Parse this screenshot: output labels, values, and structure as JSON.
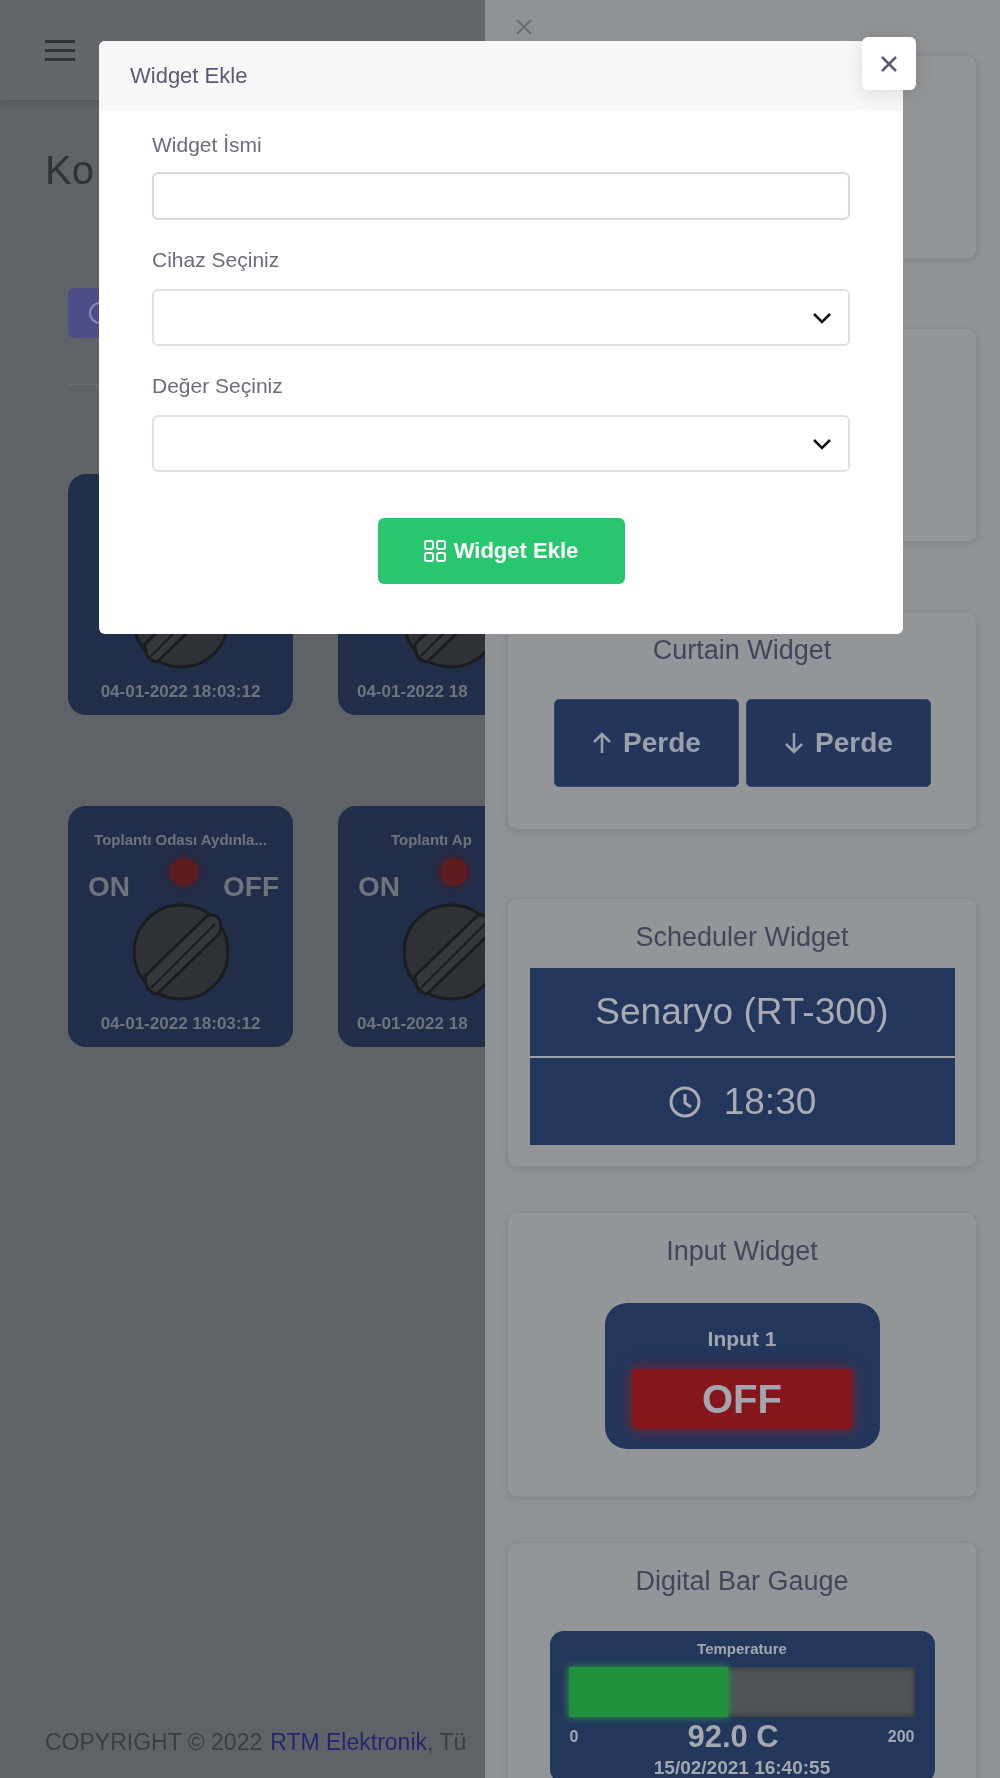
{
  "page": {
    "title": "Ko",
    "switch_rows": [
      {
        "cards": [
          {
            "date": "04-01-2022 18:03:12"
          },
          {
            "date": "04-01-2022 18"
          }
        ]
      },
      {
        "cards": [
          {
            "title": "Toplantı Odası Aydınla...",
            "on_label": "ON",
            "off_label": "OFF",
            "lamp_on": false,
            "date": "04-01-2022 18:03:12"
          },
          {
            "title": "Toplantı Ap",
            "on_label": "ON",
            "lamp_on": false,
            "date": "04-01-2022 18"
          }
        ]
      }
    ]
  },
  "footer": {
    "copyright": "COPYRIGHT © 2022",
    "company_link": "RTM Elektronik",
    "trailing": ", Tü"
  },
  "side_panel": {
    "widgets": [
      {
        "kind": "empty"
      },
      {
        "kind": "empty"
      },
      {
        "kind": "curtain",
        "title": "Curtain Widget",
        "buttons": [
          {
            "kind": "up",
            "label": "Perde"
          },
          {
            "kind": "down",
            "label": "Perde"
          }
        ]
      },
      {
        "kind": "scheduler",
        "title": "Scheduler Widget",
        "scene": "Senaryo (RT-300)",
        "time": "18:30"
      },
      {
        "kind": "input",
        "title": "Input Widget",
        "name": "Input 1",
        "value": "OFF",
        "on": false
      },
      {
        "kind": "bar_gauge",
        "title": "Digital Bar Gauge",
        "label": "Temperature",
        "level": 0.46,
        "min": "0",
        "max": "200",
        "reading": "92.0 C",
        "timestamp": "15/02/2021 16:40:55"
      }
    ]
  },
  "modal": {
    "title": "Widget Ekle",
    "fields": [
      {
        "kind": "text",
        "label": "Widget İsmi"
      },
      {
        "kind": "select",
        "label": "Cihaz Seçiniz"
      },
      {
        "kind": "select",
        "label": "Değer Seçiniz"
      }
    ],
    "submit": "Widget Ekle"
  }
}
